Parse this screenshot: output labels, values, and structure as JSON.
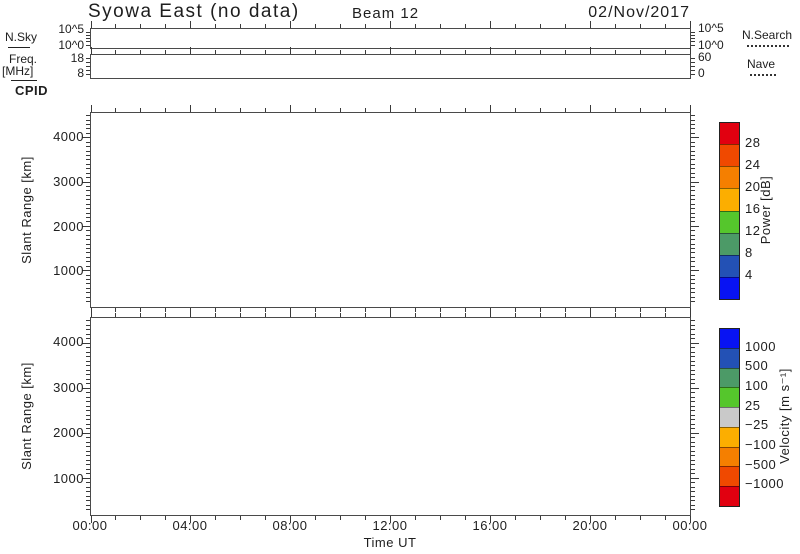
{
  "header": {
    "title": "Syowa East (no data)",
    "beam": "Beam 12",
    "date": "02/Nov/2017"
  },
  "side_labels": {
    "nsky": "N.Sky",
    "freq_line1": "Freq.",
    "freq_line2": "[MHz]",
    "cpid": "CPID",
    "nsearch": "N.Search",
    "nave": "Nave"
  },
  "panel_nsky": {
    "left_top": "10^5",
    "left_bottom": "10^0",
    "right_top": "10^5",
    "right_bottom": "10^0"
  },
  "panel_freq": {
    "left_top": "18",
    "left_bottom": "8",
    "right_top": "60",
    "right_bottom": "0"
  },
  "range_axis": {
    "label": "Slant Range [km]",
    "ticks": [
      "1000",
      "2000",
      "3000",
      "4000"
    ],
    "tick_values": [
      1000,
      2000,
      3000,
      4000
    ]
  },
  "time_axis": {
    "label": "Time UT",
    "ticks": [
      "00:00",
      "04:00",
      "08:00",
      "12:00",
      "16:00",
      "20:00",
      "00:00"
    ],
    "tick_hours": [
      0,
      4,
      8,
      12,
      16,
      20,
      24
    ]
  },
  "colorbar_power": {
    "label": "Power [dB]",
    "tick_labels": [
      "28",
      "24",
      "20",
      "16",
      "12",
      "8",
      "4"
    ],
    "colors_top_to_bottom": [
      "#e10010",
      "#f04900",
      "#f57f00",
      "#fcae00",
      "#55c62c",
      "#4c9a67",
      "#2351b5",
      "#0813f3"
    ]
  },
  "colorbar_velocity": {
    "label": "Velocity [m s⁻¹]",
    "tick_labels": [
      "1000",
      "500",
      "100",
      "25",
      "−25",
      "−100",
      "−500",
      "−1000"
    ],
    "colors_top_to_bottom": [
      "#0813f3",
      "#2351b5",
      "#4c9a67",
      "#55c62c",
      "#c9c9c9",
      "#fcae00",
      "#f57f00",
      "#f04900",
      "#e10010"
    ]
  },
  "chart_data": [
    {
      "type": "line",
      "panel": "N.Sky / N.Search",
      "y_ticks": [
        "10^5",
        "10^0"
      ],
      "legend": [
        {
          "name": "N.Sky",
          "style": "solid"
        },
        {
          "name": "N.Search",
          "style": "dotted"
        }
      ],
      "x_range_hours": [
        0,
        24
      ],
      "series": [],
      "note": "no data"
    },
    {
      "type": "line",
      "panel": "Freq [MHz] / Nave",
      "y_ticks": [
        18,
        8
      ],
      "right_y_ticks": [
        60,
        0
      ],
      "legend": [
        {
          "name": "Freq [MHz]",
          "style": "solid"
        },
        {
          "name": "Nave",
          "style": "dotted"
        }
      ],
      "x_range_hours": [
        0,
        24
      ],
      "series": [],
      "note": "no data"
    },
    {
      "type": "heatmap",
      "panel": "Power",
      "xlabel": "Time UT",
      "ylabel": "Slant Range [km]",
      "x_tick_labels": [
        "00:00",
        "04:00",
        "08:00",
        "12:00",
        "16:00",
        "20:00",
        "00:00"
      ],
      "y_tick_values": [
        1000,
        2000,
        3000,
        4000
      ],
      "ylim_km": [
        180,
        4560
      ],
      "color_levels_dB": [
        4,
        8,
        12,
        16,
        20,
        24,
        28
      ],
      "values": [],
      "note": "no data"
    },
    {
      "type": "heatmap",
      "panel": "Velocity",
      "xlabel": "Time UT",
      "ylabel": "Slant Range [km]",
      "x_tick_labels": [
        "00:00",
        "04:00",
        "08:00",
        "12:00",
        "16:00",
        "20:00",
        "00:00"
      ],
      "y_tick_values": [
        1000,
        2000,
        3000,
        4000
      ],
      "ylim_km": [
        180,
        4560
      ],
      "color_levels_m_per_s": [
        -1000,
        -500,
        -100,
        -25,
        25,
        100,
        500,
        1000
      ],
      "values": [],
      "note": "no data"
    }
  ]
}
